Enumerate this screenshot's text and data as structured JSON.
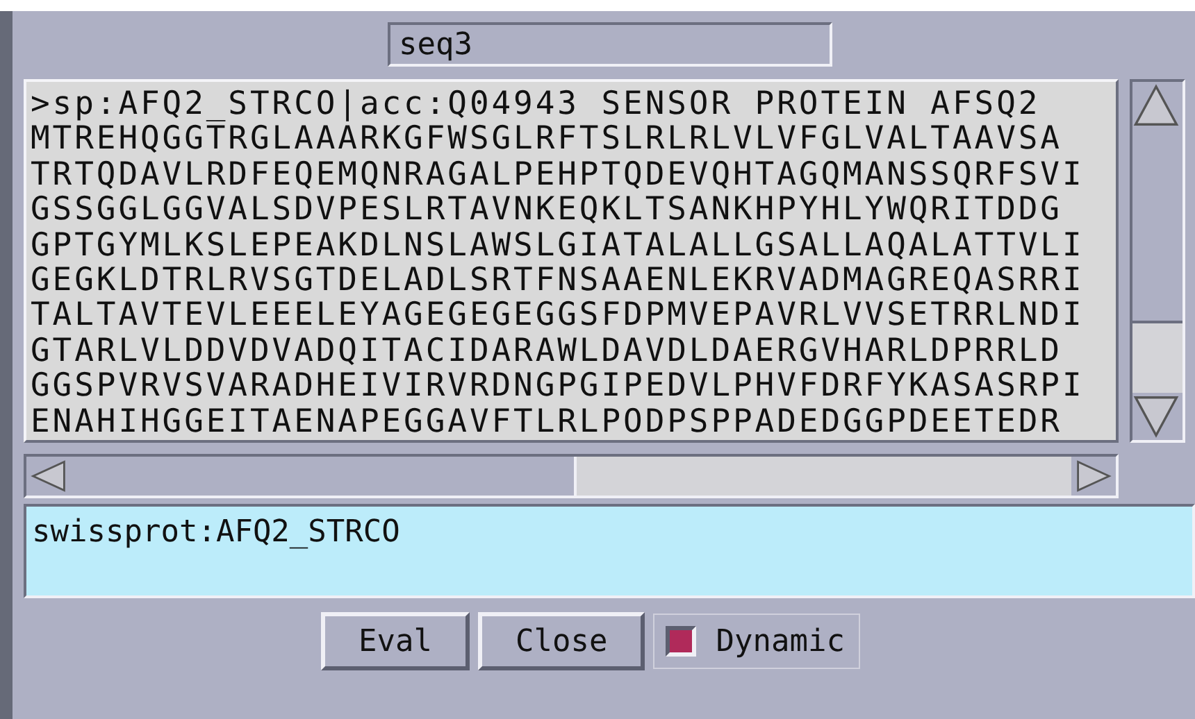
{
  "title_field": {
    "value": "seq3"
  },
  "sequence_lines": [
    ">sp:AFQ2_STRCO|acc:Q04943 SENSOR PROTEIN AFSQ2",
    "MTREHQGGTRGLAAARKGFWSGLRFTSLRLRLVLVFGLVALTAAVSA",
    "TRTQDAVLRDFEQEMQNRAGALPEHPTQDEVQHTAGQMANSSQRFSVI",
    "GSSGGLGGVALSDVPESLRTAVNKEQKLTSANKHPYHLYWQRITDDG",
    "GPTGYMLKSLEPEAKDLNSLAWSLGIATALALLGSALLAQALATTVLI",
    "GEGKLDTRLRVSGTDELADLSRTFNSAAENLEKRVADMAGREQASRRI",
    "TALTAVTEVLEEELEYAGEGEGEGGSFDPMVEPAVRLVVSETRRLNDI",
    "GTARLVLDDVDVADQITACIDARAWLDAVDLDAERGVHARLDPRRLD",
    "GGSPVRVSVARADHEIVIRVRDNGPGIPEDVLPHVFDRFYKASASRPI",
    "ENAHIHGGEITAENAPEGGAVFTLRLPODPSPPADEDGGPDEETEDR"
  ],
  "command_field": {
    "value": "swissprot:AFQ2_STRCO"
  },
  "buttons": [
    {
      "label": "Eval"
    },
    {
      "label": "Close"
    }
  ],
  "dynamic_checkbox": {
    "label": "Dynamic",
    "checked": true
  }
}
